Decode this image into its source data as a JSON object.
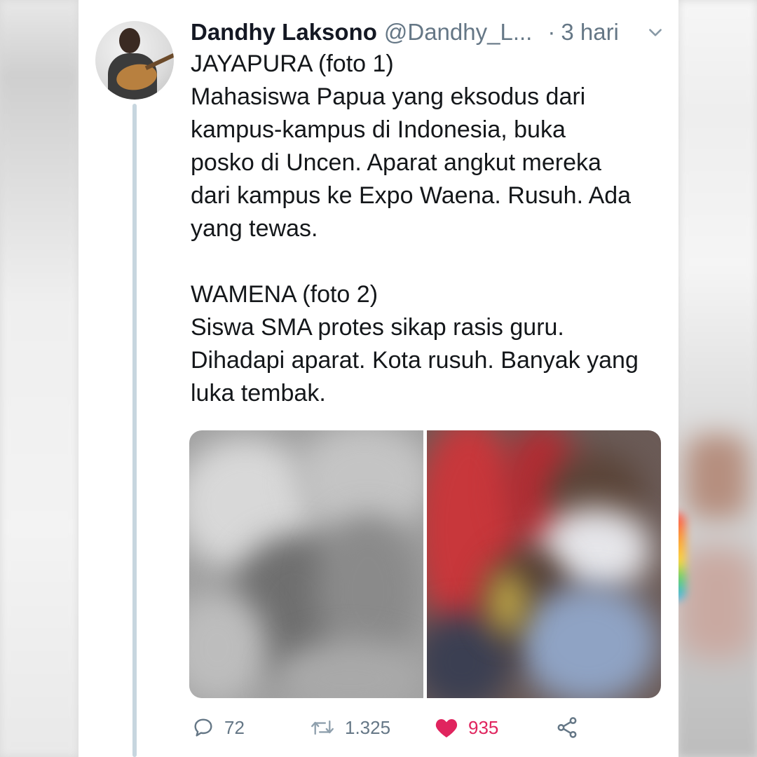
{
  "tweet": {
    "author_name": "Dandhy Laksono",
    "author_handle": "@Dandhy_L...",
    "separator": "·",
    "time": "3 hari",
    "lines": [
      "JAYAPURA (foto 1)",
      "Mahasiswa Papua yang eksodus dari",
      "kampus-kampus di Indonesia, buka",
      "posko di Uncen. Aparat angkut mereka",
      "dari kampus ke Expo Waena. Rusuh. Ada",
      "yang tewas.",
      "",
      "WAMENA (foto 2)",
      "Siswa SMA protes sikap rasis guru.",
      "Dihadapi aparat. Kota rusuh. Banyak yang",
      "luka tembak."
    ]
  },
  "actions": {
    "reply_count": "72",
    "retweet_count": "1.325",
    "like_count": "935"
  },
  "colors": {
    "like_active": "#e0245e",
    "secondary_text": "#657786",
    "thread_line": "#c7d6df"
  },
  "icons": [
    "caret-down-icon",
    "reply-icon",
    "retweet-icon",
    "heart-icon",
    "share-icon"
  ]
}
